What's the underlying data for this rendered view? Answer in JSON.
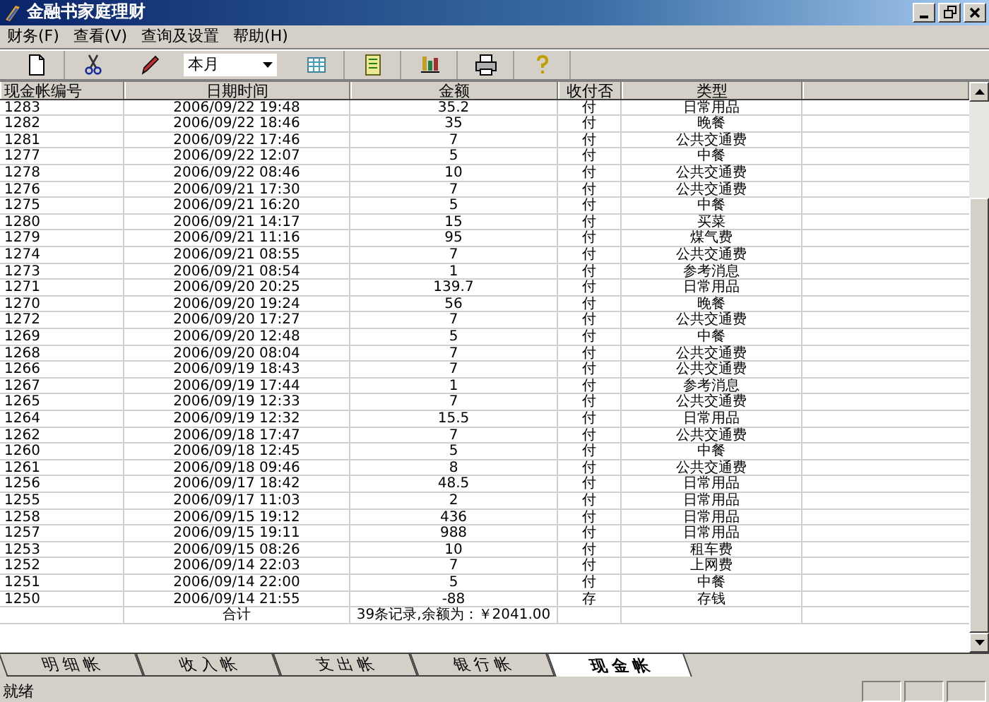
{
  "window": {
    "title": "金融书家庭理财"
  },
  "menu": [
    "财务(F)",
    "查看(V)",
    "查询及设置",
    "帮助(H)"
  ],
  "toolbar": {
    "period": "本月"
  },
  "table": {
    "columns": [
      "现金帐编号",
      "日期时间",
      "金额",
      "收付否",
      "类型"
    ],
    "rows": [
      [
        "1283",
        "2006/09/22 19:48",
        "35.2",
        "付",
        "日常用品"
      ],
      [
        "1282",
        "2006/09/22 18:46",
        "35",
        "付",
        "晚餐"
      ],
      [
        "1281",
        "2006/09/22 17:46",
        "7",
        "付",
        "公共交通费"
      ],
      [
        "1277",
        "2006/09/22 12:07",
        "5",
        "付",
        "中餐"
      ],
      [
        "1278",
        "2006/09/22 08:46",
        "10",
        "付",
        "公共交通费"
      ],
      [
        "1276",
        "2006/09/21 17:30",
        "7",
        "付",
        "公共交通费"
      ],
      [
        "1275",
        "2006/09/21 16:20",
        "5",
        "付",
        "中餐"
      ],
      [
        "1280",
        "2006/09/21 14:17",
        "15",
        "付",
        "买菜"
      ],
      [
        "1279",
        "2006/09/21 11:16",
        "95",
        "付",
        "煤气费"
      ],
      [
        "1274",
        "2006/09/21 08:55",
        "7",
        "付",
        "公共交通费"
      ],
      [
        "1273",
        "2006/09/21 08:54",
        "1",
        "付",
        "参考消息"
      ],
      [
        "1271",
        "2006/09/20 20:25",
        "139.7",
        "付",
        "日常用品"
      ],
      [
        "1270",
        "2006/09/20 19:24",
        "56",
        "付",
        "晚餐"
      ],
      [
        "1272",
        "2006/09/20 17:27",
        "7",
        "付",
        "公共交通费"
      ],
      [
        "1269",
        "2006/09/20 12:48",
        "5",
        "付",
        "中餐"
      ],
      [
        "1268",
        "2006/09/20 08:04",
        "7",
        "付",
        "公共交通费"
      ],
      [
        "1266",
        "2006/09/19 18:43",
        "7",
        "付",
        "公共交通费"
      ],
      [
        "1267",
        "2006/09/19 17:44",
        "1",
        "付",
        "参考消息"
      ],
      [
        "1265",
        "2006/09/19 12:33",
        "7",
        "付",
        "公共交通费"
      ],
      [
        "1264",
        "2006/09/19 12:32",
        "15.5",
        "付",
        "日常用品"
      ],
      [
        "1262",
        "2006/09/18 17:47",
        "7",
        "付",
        "公共交通费"
      ],
      [
        "1260",
        "2006/09/18 12:45",
        "5",
        "付",
        "中餐"
      ],
      [
        "1261",
        "2006/09/18 09:46",
        "8",
        "付",
        "公共交通费"
      ],
      [
        "1256",
        "2006/09/17 18:42",
        "48.5",
        "付",
        "日常用品"
      ],
      [
        "1255",
        "2006/09/17 11:03",
        "2",
        "付",
        "日常用品"
      ],
      [
        "1258",
        "2006/09/15 19:12",
        "436",
        "付",
        "日常用品"
      ],
      [
        "1257",
        "2006/09/15 19:11",
        "988",
        "付",
        "日常用品"
      ],
      [
        "1253",
        "2006/09/15 08:26",
        "10",
        "付",
        "租车费"
      ],
      [
        "1252",
        "2006/09/14 22:03",
        "7",
        "付",
        "上网费"
      ],
      [
        "1251",
        "2006/09/14 22:00",
        "5",
        "付",
        "中餐"
      ],
      [
        "1250",
        "2006/09/14 21:55",
        "-88",
        "存",
        "存钱"
      ]
    ],
    "total": {
      "label": "合计",
      "summary": "39条记录,余额为：￥2041.00"
    }
  },
  "tabs": [
    {
      "label": "明 细 帐",
      "selected": false
    },
    {
      "label": "收 入 帐",
      "selected": false
    },
    {
      "label": "支 出 帐",
      "selected": false
    },
    {
      "label": "银 行 帐",
      "selected": false
    },
    {
      "label": "现 金 帐",
      "selected": true
    }
  ],
  "status_bar": "就绪"
}
